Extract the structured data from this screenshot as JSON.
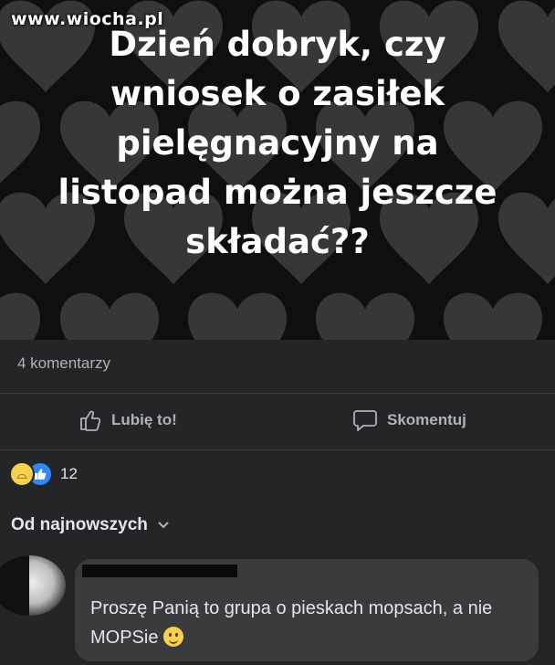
{
  "watermark": "www.wiocha.pl",
  "post": {
    "text": "Dzień dobryk, czy\nwniosek o zasiłek\npielęgnacyjny na\nlistopad można jeszcze\nskładać??"
  },
  "stats": {
    "comments_count": "4 komentarzy",
    "reactions_count": "12"
  },
  "actions": {
    "like_label": "Lubię to!",
    "comment_label": "Skomentuj"
  },
  "sort": {
    "label": "Od najnowszych"
  },
  "comment": {
    "text": "Proszę Panią to grupa o pieskach mopsach, a nie MOPSie"
  },
  "colors": {
    "post_background": "#0f0f10",
    "heart": "#3a3a3c",
    "panel": "#242526",
    "bubble": "#3a3b3c",
    "like_blue": "#2d88ff"
  }
}
